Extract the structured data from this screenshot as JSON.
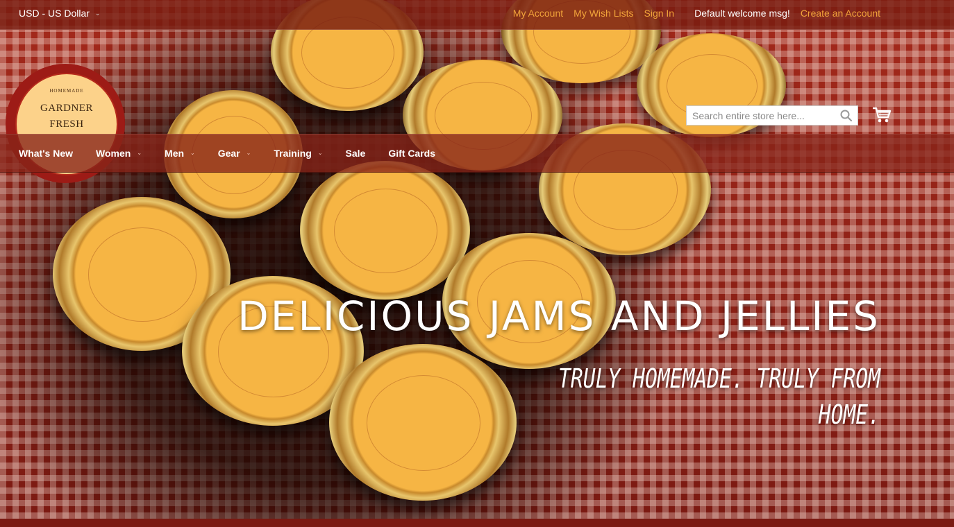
{
  "topbar": {
    "currency": "USD - US Dollar",
    "links": {
      "my_account": "My Account",
      "my_wish_lists": "My Wish Lists",
      "sign_in": "Sign In",
      "welcome": "Default welcome msg!",
      "create_account": "Create an Account"
    }
  },
  "logo": {
    "small_text": "HOMEMADE",
    "line1": "GARDNER",
    "line2": "FRESH"
  },
  "search": {
    "placeholder": "Search entire store here..."
  },
  "nav": {
    "items": [
      {
        "label": "What's New"
      },
      {
        "label": "Women"
      },
      {
        "label": "Men"
      },
      {
        "label": "Gear"
      },
      {
        "label": "Training"
      },
      {
        "label": "Sale"
      },
      {
        "label": "Gift Cards"
      }
    ]
  },
  "hero": {
    "headline": "DELICIOUS JAMS AND JELLIES",
    "subline": "TRULY HOMEMADE. TRULY FROM HOME."
  },
  "colors": {
    "link_accent": "#f0a33a",
    "bar_bg": "#7a1c10",
    "nav_bg": "#872418",
    "logo_red": "#9d1b16",
    "logo_cream": "#fcd28a"
  },
  "icons": {
    "currency_dropdown": "chevron-down-icon",
    "search": "search-icon",
    "cart": "shopping-cart-icon"
  }
}
